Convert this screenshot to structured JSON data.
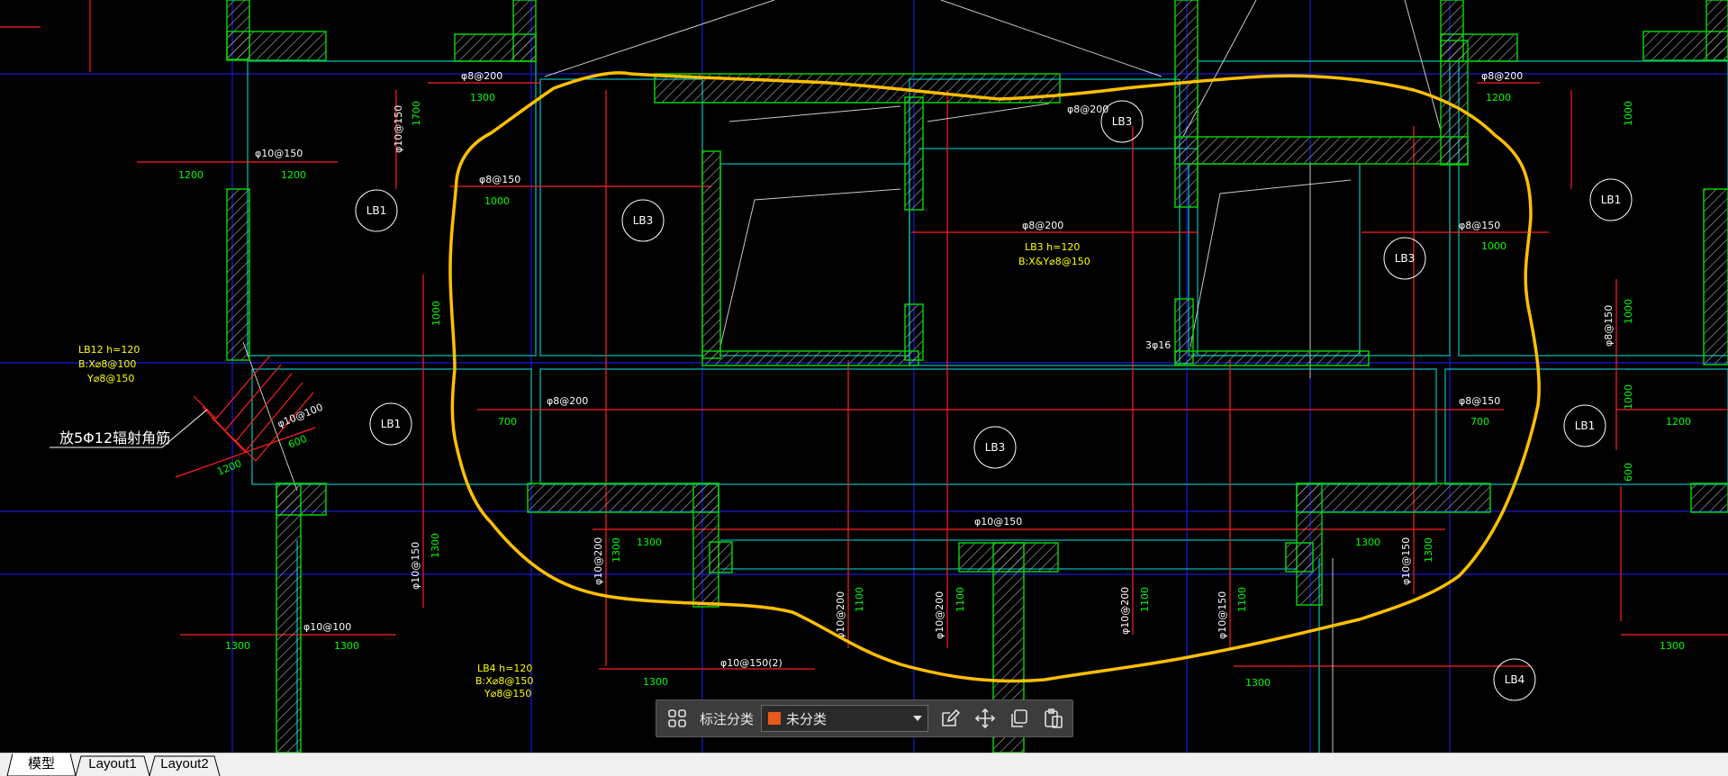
{
  "colors": {
    "background": "#000000",
    "wall": "#00c800",
    "grid": "#2020ff",
    "rebar": "#ff2020",
    "slab": "#00b4b4",
    "dim_text": "#00ff00",
    "note_text": "#ffff00",
    "markup": "#ffc000",
    "tab_bar": "#f0f0f0"
  },
  "drawing": {
    "slab_labels": [
      "LB1",
      "LB3",
      "LB3",
      "LB1",
      "LB3",
      "LB1",
      "LB3",
      "LB1",
      "LB1",
      "LB4"
    ],
    "rebar_labels": [
      "φ8@200",
      "φ10@150",
      "φ8@150",
      "φ8@200",
      "φ8@150",
      "φ8@200",
      "φ8@200",
      "φ10@100",
      "φ10@150",
      "φ10@150",
      "φ10@100",
      "φ10@150(2)",
      "φ8@200",
      "φ10@200",
      "φ10@200",
      "φ10@200",
      "φ10@200",
      "φ10@150",
      "φ10@150",
      "φ8@150",
      "φ10@150",
      "φ8@150",
      "3φ16"
    ],
    "dimensions": [
      "1300",
      "1700",
      "1200",
      "1200",
      "1000",
      "1000",
      "1200",
      "1000",
      "700",
      "700",
      "1000",
      "1200",
      "600",
      "1200",
      "600",
      "1000",
      "1300",
      "1300",
      "1300",
      "1300",
      "1300",
      "1100",
      "1100",
      "1100",
      "1100",
      "1300",
      "1300",
      "1300",
      "1300",
      "1000",
      "1300"
    ],
    "notes": {
      "lb3_h": "LB3  h=120",
      "lb3_bar": "B:X&Y⌀8@150",
      "lb2_h": "LB12  h=120",
      "lb2_bx": "B:X⌀8@100",
      "lb2_by": "Y⌀8@150",
      "corner_bars": "放5Φ12辐射角筋",
      "lb4_h": "LB4  h=120",
      "lb4_bx": "B:X⌀8@150",
      "lb4_by": "Y⌀8@150"
    }
  },
  "markup_toolbar": {
    "grid_icon": "grid-icon",
    "label": "标注分类",
    "category": "未分类",
    "category_color": "#e85a1a",
    "icons": [
      "edit-icon",
      "move-icon",
      "copy-icon",
      "paste-icon"
    ]
  },
  "tabs": [
    {
      "label": "模型",
      "active": true
    },
    {
      "label": "Layout1",
      "active": false
    },
    {
      "label": "Layout2",
      "active": false
    }
  ]
}
